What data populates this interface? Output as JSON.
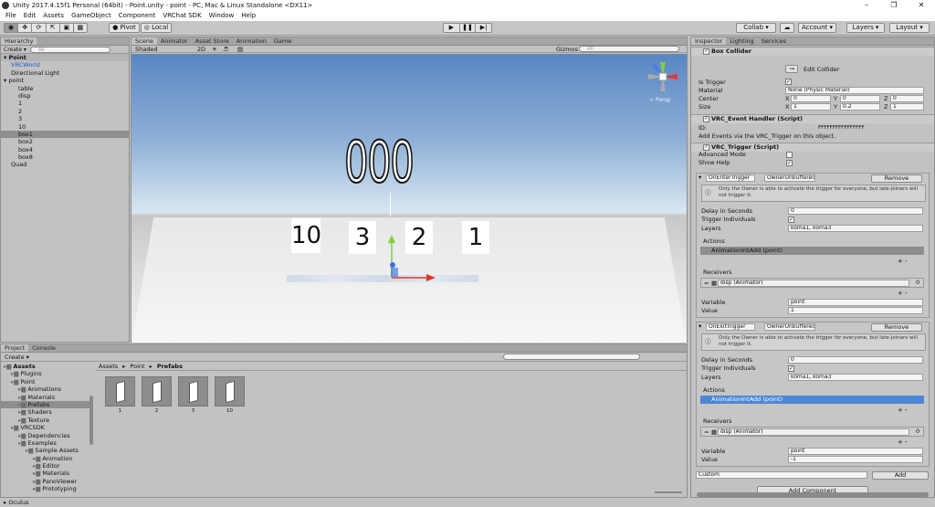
{
  "title": "Unity 2017.4.15f1 Personal (64bit) - Point.unity - point - PC, Mac & Linux Standalone <DX11>",
  "window_buttons": [
    "–",
    "❐",
    "✕"
  ],
  "menu": [
    "File",
    "Edit",
    "Assets",
    "GameObject",
    "Component",
    "VRChat SDK",
    "Window",
    "Help"
  ],
  "toolbar": {
    "pivot": "Pivot",
    "local": "Local",
    "collab": "Collab ▾",
    "account": "Account ▾",
    "layers": "Layers ▾",
    "layout": "Layout ▾"
  },
  "hierarchy": {
    "tab": "Hierarchy",
    "create": "Create ▾",
    "search": "All",
    "scene": "Point",
    "items": [
      {
        "label": "VRCWorld",
        "indent": 1,
        "selected": false,
        "blue": true
      },
      {
        "label": "Directional Light",
        "indent": 1,
        "selected": false
      },
      {
        "label": "point",
        "indent": 1,
        "selected": false,
        "arrow": true
      },
      {
        "label": "table",
        "indent": 2,
        "selected": false
      },
      {
        "label": "disp",
        "indent": 2,
        "selected": false
      },
      {
        "label": "1",
        "indent": 2,
        "selected": false
      },
      {
        "label": "2",
        "indent": 2,
        "selected": false
      },
      {
        "label": "3",
        "indent": 2,
        "selected": false
      },
      {
        "label": "10",
        "indent": 2,
        "selected": false
      },
      {
        "label": "box1",
        "indent": 2,
        "selected": true
      },
      {
        "label": "box2",
        "indent": 2,
        "selected": false
      },
      {
        "label": "box4",
        "indent": 2,
        "selected": false
      },
      {
        "label": "box8",
        "indent": 2,
        "selected": false
      },
      {
        "label": "Quad",
        "indent": 1,
        "selected": false
      }
    ]
  },
  "scene_tabs": [
    "Scene",
    "Animator",
    "Asset Store",
    "Animation",
    "Game"
  ],
  "scene_toolbar": {
    "shaded": "Shaded",
    "mode2d": "2D",
    "gizmos": "Gizmos ▾",
    "search": "All"
  },
  "scene": {
    "score": "000",
    "cards": [
      "10",
      "3",
      "2",
      "1"
    ],
    "persp": "< Persp"
  },
  "inspector": {
    "tabs": [
      "Inspector",
      "Lighting",
      "Services"
    ],
    "box_collider": {
      "title": "Box Collider",
      "edit": "Edit Collider",
      "is_trigger": "Is Trigger",
      "material_label": "Material",
      "material": "None (Physic Material)",
      "center": "Center",
      "size": "Size",
      "center_vals": [
        "0",
        "0",
        "0"
      ],
      "size_vals": [
        "1",
        "0.2",
        "1"
      ],
      "axes": [
        "X",
        "Y",
        "Z"
      ]
    },
    "event_handler": {
      "title": "VRC_Event Handler (Script)",
      "id_label": "ID:",
      "id": "FFFFFFFFFFFFFFFF",
      "note": "Add Events via the VRC_Trigger on this object."
    },
    "trigger": {
      "title": "VRC_Trigger (Script)",
      "advanced": "Advanced Mode",
      "show_help": "Show Help",
      "blocks": [
        {
          "trigger": "OnEnterTrigger",
          "owner": "OwnerUnbuffered ‡",
          "remove": "Remove",
          "help": "Only the Owner is able to activate the trigger for everyone, but late-joiners will not trigger it.",
          "delay_label": "Delay in Seconds",
          "delay": "0",
          "individuals": "Trigger Individuals",
          "layers_label": "Layers",
          "layers": "koma1, koma3",
          "actions": "Actions",
          "action": "AnimationIntAdd (point)",
          "receivers": "Receivers",
          "receiver": "disp (Animator)",
          "receiver_count": "0",
          "variable_label": "Variable",
          "variable": "point",
          "value_label": "Value",
          "value": "1"
        },
        {
          "trigger": "OnExitTrigger",
          "owner": "OwnerUnbuffered ‡",
          "remove": "Remove",
          "help": "Only the Owner is able to activate the trigger for everyone, but late-joiners will not trigger it.",
          "delay_label": "Delay in Seconds",
          "delay": "0",
          "individuals": "Trigger Individuals",
          "layers_label": "Layers",
          "layers": "koma1, koma3",
          "actions": "Actions",
          "action": "AnimationIntAdd (point)",
          "receivers": "Receivers",
          "receiver": "disp (Animator)",
          "receiver_count": "0",
          "variable_label": "Variable",
          "variable": "point",
          "value_label": "Value",
          "value": "-1"
        }
      ],
      "custom": "Custom",
      "add": "Add"
    },
    "add_component": "Add Component"
  },
  "project": {
    "tabs": [
      "Project",
      "Console"
    ],
    "create": "Create ▾",
    "breadcrumb": [
      "Assets",
      "Point",
      "Prefabs"
    ],
    "tree": [
      {
        "label": "Assets",
        "indent": 0,
        "bold": true
      },
      {
        "label": "Plugins",
        "indent": 1
      },
      {
        "label": "Point",
        "indent": 1
      },
      {
        "label": "Animations",
        "indent": 2
      },
      {
        "label": "Materials",
        "indent": 2
      },
      {
        "label": "Prefabs",
        "indent": 2,
        "selected": true
      },
      {
        "label": "Shaders",
        "indent": 2
      },
      {
        "label": "Texture",
        "indent": 2
      },
      {
        "label": "VRCSDK",
        "indent": 1
      },
      {
        "label": "Dependencies",
        "indent": 2
      },
      {
        "label": "Examples",
        "indent": 2
      },
      {
        "label": "Sample Assets",
        "indent": 3
      },
      {
        "label": "Animation",
        "indent": 4
      },
      {
        "label": "Editor",
        "indent": 4
      },
      {
        "label": "Materials",
        "indent": 4
      },
      {
        "label": "PanoViewer",
        "indent": 4
      },
      {
        "label": "Prototyping",
        "indent": 4
      }
    ],
    "files": [
      "1",
      "2",
      "3",
      "10"
    ]
  },
  "status": "Oculus",
  "colors": {
    "selection_blue": "#4d86d6",
    "sky_top": "#5a86c4",
    "sky_bottom": "#d8e6f1"
  }
}
